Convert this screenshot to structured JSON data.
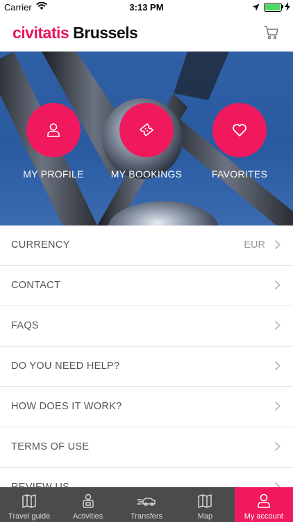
{
  "status": {
    "carrier": "Carrier",
    "time": "3:13 PM"
  },
  "header": {
    "brand": "civitatis",
    "city": "Brussels"
  },
  "actions": [
    {
      "label": "MY PROFILE",
      "icon": "user-icon"
    },
    {
      "label": "MY BOOKINGS",
      "icon": "ticket-icon"
    },
    {
      "label": "FAVORITES",
      "icon": "heart-icon"
    }
  ],
  "menu": [
    {
      "label": "CURRENCY",
      "value": "EUR"
    },
    {
      "label": "CONTACT"
    },
    {
      "label": "FAQS"
    },
    {
      "label": "DO YOU NEED HELP?"
    },
    {
      "label": "HOW DOES IT WORK?"
    },
    {
      "label": "TERMS OF USE"
    },
    {
      "label": "REVIEW US"
    }
  ],
  "tabs": [
    {
      "label": "Travel guide",
      "icon": "map-book-icon"
    },
    {
      "label": "Activities",
      "icon": "guide-person-icon"
    },
    {
      "label": "Transfers",
      "icon": "car-icon"
    },
    {
      "label": "Map",
      "icon": "map-icon"
    },
    {
      "label": "My account",
      "icon": "account-icon",
      "active": true
    }
  ],
  "colors": {
    "accent": "#f0195e",
    "tabbar": "#4b4b4b"
  }
}
